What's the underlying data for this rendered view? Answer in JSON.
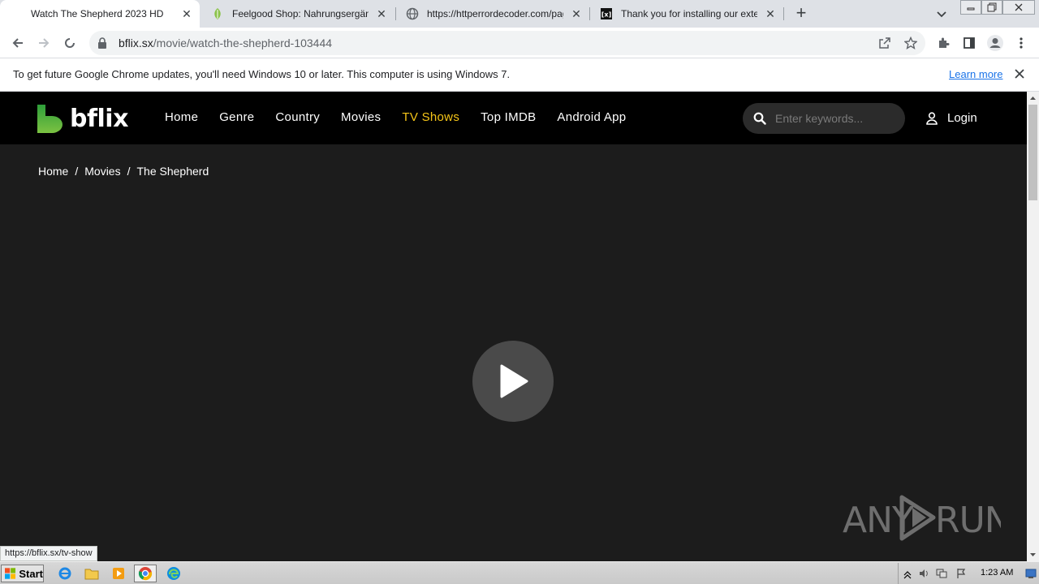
{
  "browser": {
    "tabs": [
      {
        "title": "Watch The Shepherd 2023 HD",
        "active": true,
        "favicon": "bflix-icon"
      },
      {
        "title": "Feelgood Shop: Nahrungsergänzungsmittel",
        "active": false,
        "favicon": "leaf-icon"
      },
      {
        "title": "https://httperrordecoder.com/page/",
        "active": false,
        "favicon": "globe-icon"
      },
      {
        "title": "Thank you for installing our extension",
        "active": false,
        "favicon": "extension-logo-icon"
      }
    ],
    "new_tab_label": "+",
    "url_host": "bflix.sx",
    "url_path": "/movie/watch-the-shepherd-103444",
    "status_url": "https://bflix.sx/tv-show"
  },
  "infobar": {
    "message": "To get future Google Chrome updates, you'll need Windows 10 or later. This computer is using Windows 7.",
    "learn_more": "Learn more"
  },
  "site": {
    "logo_text": "bflix",
    "nav": [
      {
        "label": "Home",
        "highlight": false
      },
      {
        "label": "Genre",
        "highlight": false
      },
      {
        "label": "Country",
        "highlight": false
      },
      {
        "label": "Movies",
        "highlight": false
      },
      {
        "label": "TV Shows",
        "highlight": true
      },
      {
        "label": "Top IMDB",
        "highlight": false
      },
      {
        "label": "Android App",
        "highlight": false
      }
    ],
    "search_placeholder": "Enter keywords...",
    "login_label": "Login",
    "breadcrumb": [
      "Home",
      "Movies",
      "The Shepherd"
    ],
    "breadcrumb_sep": "/"
  },
  "watermark": "ANY RUN",
  "taskbar": {
    "start_label": "Start",
    "clock": "1:23 AM"
  },
  "colors": {
    "accent_nav": "#f5c518",
    "logo_green": "#3fae3f",
    "page_bg": "#1c1c1c",
    "header_bg": "#000000"
  }
}
